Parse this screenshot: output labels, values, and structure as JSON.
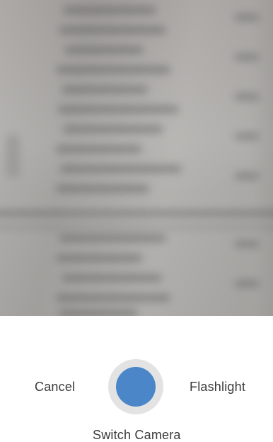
{
  "camera": {
    "cancel_label": "Cancel",
    "flashlight_label": "Flashlight",
    "switch_camera_label": "Switch Camera"
  },
  "colors": {
    "shutter_inner": "#4a86c8",
    "shutter_ring": "#e3e3e3",
    "label_text": "#3a3a3a",
    "control_background": "#ffffff"
  },
  "icons": {
    "shutter": "shutter-button-circle"
  }
}
